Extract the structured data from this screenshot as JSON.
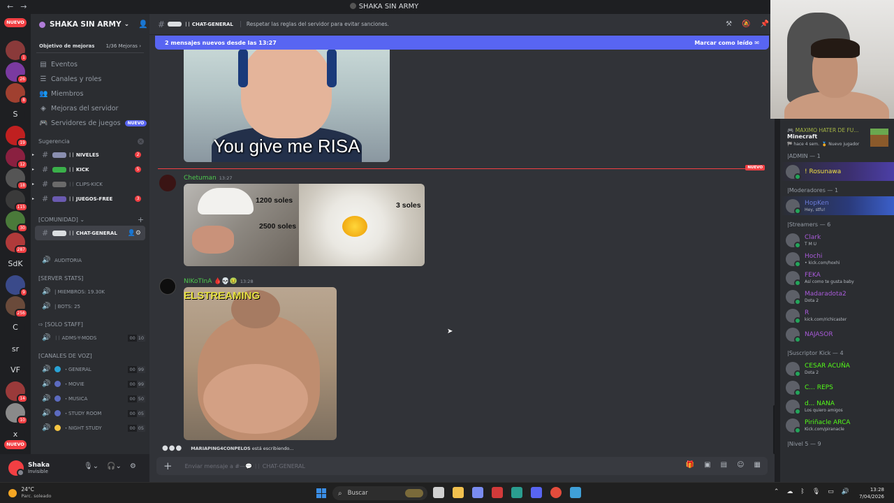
{
  "window": {
    "title": "SHAKA SIN ARMY"
  },
  "rail": {
    "nuevo_top": "NUEVO",
    "nuevo_bottom": "NUEVO",
    "servers": [
      {
        "label": "",
        "badge": "1",
        "color": "#8a3a3a"
      },
      {
        "label": "",
        "badge": "26",
        "color": "#7a3aa0"
      },
      {
        "label": "",
        "badge": "8",
        "color": "#a04030"
      },
      {
        "label": "S",
        "badge": "",
        "color": ""
      },
      {
        "label": "",
        "badge": "19",
        "color": "#c02020"
      },
      {
        "label": "",
        "badge": "12",
        "color": "#8a2040"
      },
      {
        "label": "",
        "badge": "18",
        "color": "#555555"
      },
      {
        "label": "",
        "badge": "115",
        "color": "#3a3a3a"
      },
      {
        "label": "",
        "badge": "30",
        "color": "#4a7a3a"
      },
      {
        "label": "",
        "badge": "287",
        "color": "#b03a3a"
      },
      {
        "label": "SdK",
        "badge": "",
        "color": ""
      },
      {
        "label": "",
        "badge": "9",
        "color": "#3a4a8a"
      },
      {
        "label": "",
        "badge": "256",
        "color": "#6a4a3a"
      },
      {
        "label": "C",
        "badge": "",
        "color": ""
      },
      {
        "label": "sr",
        "badge": "",
        "color": ""
      },
      {
        "label": "VF",
        "badge": "",
        "color": ""
      },
      {
        "label": "",
        "badge": "14",
        "color": "#9a3a3a"
      },
      {
        "label": "",
        "badge": "10",
        "color": "#8a8a8a"
      },
      {
        "label": "x",
        "badge": "",
        "color": ""
      }
    ]
  },
  "sidebar": {
    "guild_name": "SHAKA SIN ARMY",
    "boost_goal": "Objetivo de mejoras",
    "boost_progress": "1/36 Mejoras",
    "menu": [
      {
        "label": "Eventos",
        "icon": "calendar-icon"
      },
      {
        "label": "Canales y roles",
        "icon": "list-icon"
      },
      {
        "label": "Miembros",
        "icon": "members-icon"
      },
      {
        "label": "Mejoras del servidor",
        "icon": "boost-icon"
      },
      {
        "label": "Servidores de juegos",
        "icon": "gamepad-icon",
        "tag": "NUEVO"
      }
    ],
    "suggestion_label": "Sugerencia",
    "suggested_channels": [
      {
        "name": "NIVELES",
        "count": "2"
      },
      {
        "name": "KICK",
        "count": "5"
      },
      {
        "name": "CLIPS-KICK",
        "count": ""
      },
      {
        "name": "JUEGOS-FREE",
        "count": "3"
      }
    ],
    "community_label": "[COMUNIDAD]",
    "active_channel": "CHAT-GENERAL",
    "auditoria": "AUDITORIA",
    "server_stats_label": "[SERVER STATS]",
    "stats": [
      {
        "label": "MIEMBROS: 19.30k"
      },
      {
        "label": "BOTS: 25"
      }
    ],
    "solo_staff_label": "[SOLO STAFF]",
    "staff_voice": {
      "name": "ADMS-Y-MODS",
      "a": "00",
      "b": "10"
    },
    "voice_label": "[CANALES DE VOZ]",
    "voice": [
      {
        "name": "GENERAL",
        "a": "00",
        "b": "99"
      },
      {
        "name": "MOVIE",
        "a": "00",
        "b": "99"
      },
      {
        "name": "MUSICA",
        "a": "00",
        "b": "50"
      },
      {
        "name": "STUDY ROOM",
        "a": "00",
        "b": "05"
      },
      {
        "name": "NIGHT STUDY",
        "a": "00",
        "b": "05"
      }
    ]
  },
  "user": {
    "name": "Shaka",
    "status": "Invisible"
  },
  "chat": {
    "channel": "CHAT-GENERAL",
    "topic": "Respetar las reglas del servidor para evitar sanciones.",
    "new_messages": "2 mensajes nuevos desde las 13:27",
    "mark_read": "Marcar como leído",
    "meme_caption": "You give me RISA",
    "new_tag": "NUEVO",
    "messages": [
      {
        "author": "Chetuman",
        "time": "13:27",
        "color": "#4ec94e"
      },
      {
        "author": "NIKoTInA",
        "time": "13:28",
        "color": "#4ec94e"
      }
    ],
    "image_labels": [
      "1200 soles",
      "2500 soles",
      "3 soles"
    ],
    "gif_banner": "ELSTREAMING",
    "typing_user": "MARIAPING4CONPELOS",
    "typing_text": "está escribiendo...",
    "composer_placeholder": "Enviar mensaje a #—💬 ᛁᛁ CHAT-GENERAL"
  },
  "members": {
    "game": {
      "who": "MAXIMO HATER DE FU...",
      "title": "Minecraft",
      "meta_time": "hace 4 sem.",
      "meta_tag": "Nuevo jugador"
    },
    "groups": [
      {
        "label": "ADMIN — 1",
        "items": [
          {
            "name": "! Rosunawa",
            "status": "",
            "color": "#f0e040",
            "hl": "hl"
          }
        ]
      },
      {
        "label": "Moderadores — 1",
        "items": [
          {
            "name": "HopKen",
            "status": "Hey, stfu!",
            "color": "#6b7bd8",
            "hl": "hl2"
          }
        ]
      },
      {
        "label": "Streamers — 6",
        "items": [
          {
            "name": "Clark",
            "status": "T M U",
            "color": "#a85ad8",
            "hl": ""
          },
          {
            "name": "Hochi",
            "status": "• kick.com/hoxhi",
            "color": "#a85ad8",
            "hl": ""
          },
          {
            "name": "FEKA",
            "status": "Así como te gusta baby",
            "color": "#a85ad8",
            "hl": ""
          },
          {
            "name": "Madaradota2",
            "status": "Dota 2",
            "color": "#a85ad8",
            "hl": ""
          },
          {
            "name": "R",
            "status": "kick.com/richicaster",
            "color": "#a85ad8",
            "hl": ""
          },
          {
            "name": "NAJASOR",
            "status": "",
            "color": "#a85ad8",
            "hl": ""
          }
        ]
      },
      {
        "label": "Suscriptor Kick — 4",
        "items": [
          {
            "name": "CESAR ACUÑA",
            "status": "Dota 2",
            "color": "#53fc18",
            "hl": ""
          },
          {
            "name": "C... REPS",
            "status": "",
            "color": "#53fc18",
            "hl": ""
          },
          {
            "name": "d... NANA",
            "status": "Los quiero amigos",
            "color": "#53fc18",
            "hl": ""
          },
          {
            "name": "Piriñacle ARCA",
            "status": "Kick.com/piranacle",
            "color": "#53fc18",
            "hl": ""
          }
        ]
      },
      {
        "label": "Nivel 5 — 9",
        "items": []
      }
    ]
  },
  "taskbar": {
    "temp": "24°C",
    "weather": "Parc. soleado",
    "search": "Buscar",
    "time": "13:28",
    "date": "7/04/2026"
  }
}
